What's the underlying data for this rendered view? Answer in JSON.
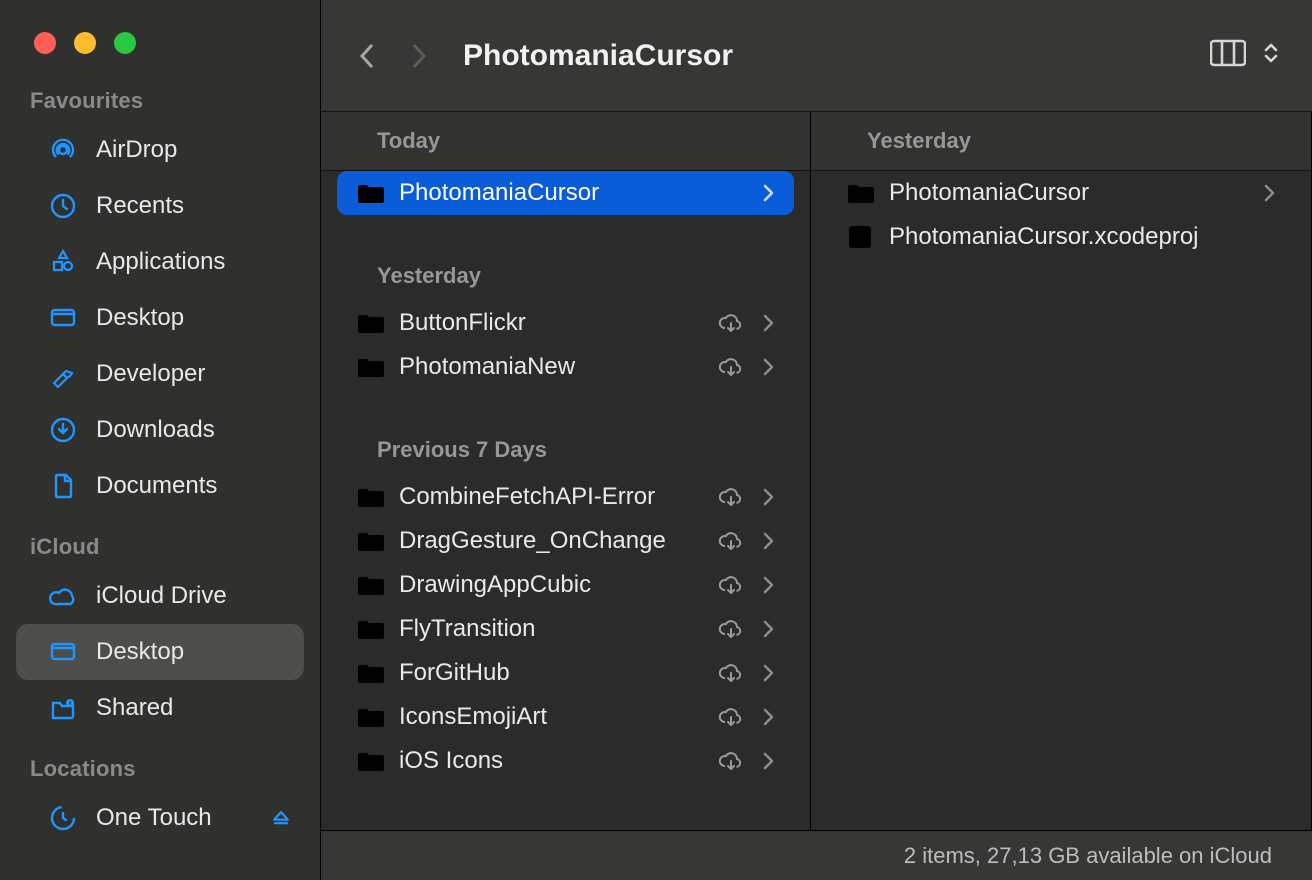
{
  "sidebar": {
    "sections": [
      {
        "label": "Favourites",
        "items": [
          {
            "label": "AirDrop",
            "icon": "airdrop"
          },
          {
            "label": "Recents",
            "icon": "clock"
          },
          {
            "label": "Applications",
            "icon": "apps"
          },
          {
            "label": "Desktop",
            "icon": "desktop"
          },
          {
            "label": "Developer",
            "icon": "hammer"
          },
          {
            "label": "Downloads",
            "icon": "download"
          },
          {
            "label": "Documents",
            "icon": "document"
          }
        ]
      },
      {
        "label": "iCloud",
        "items": [
          {
            "label": "iCloud Drive",
            "icon": "cloud"
          },
          {
            "label": "Desktop",
            "icon": "desktop",
            "selected": true
          },
          {
            "label": "Shared",
            "icon": "shared-folder"
          }
        ]
      },
      {
        "label": "Locations",
        "items": [
          {
            "label": "One Touch",
            "icon": "time-machine",
            "ejectable": true
          }
        ]
      }
    ]
  },
  "toolbar": {
    "title": "PhotomaniaCursor",
    "back_enabled": true,
    "forward_enabled": false
  },
  "columns": [
    {
      "groups": [
        {
          "label": "Today",
          "items": [
            {
              "name": "PhotomaniaCursor",
              "kind": "folder",
              "selected": true,
              "has_children": true
            }
          ]
        },
        {
          "label": "Yesterday",
          "items": [
            {
              "name": "ButtonFlickr",
              "kind": "folder",
              "cloud": true,
              "has_children": true
            },
            {
              "name": "PhotomaniaNew",
              "kind": "folder",
              "cloud": true,
              "has_children": true
            }
          ]
        },
        {
          "label": "Previous 7 Days",
          "items": [
            {
              "name": "CombineFetchAPI-Error",
              "kind": "folder",
              "cloud": true,
              "has_children": true
            },
            {
              "name": "DragGesture_OnChange",
              "kind": "folder",
              "cloud": true,
              "has_children": true
            },
            {
              "name": "DrawingAppCubic",
              "kind": "folder",
              "cloud": true,
              "has_children": true
            },
            {
              "name": "FlyTransition",
              "kind": "folder",
              "cloud": true,
              "has_children": true
            },
            {
              "name": "ForGitHub",
              "kind": "folder",
              "cloud": true,
              "has_children": true
            },
            {
              "name": "IconsEmojiArt",
              "kind": "folder",
              "cloud": true,
              "has_children": true
            },
            {
              "name": "iOS Icons",
              "kind": "folder",
              "cloud": true,
              "has_children": true
            }
          ]
        }
      ]
    },
    {
      "groups": [
        {
          "label": "Yesterday",
          "items": [
            {
              "name": "PhotomaniaCursor",
              "kind": "folder",
              "has_children": true
            },
            {
              "name": "PhotomaniaCursor.xcodeproj",
              "kind": "xcodeproj"
            }
          ]
        }
      ]
    }
  ],
  "statusbar": {
    "text": "2 items, 27,13 GB available on iCloud"
  }
}
